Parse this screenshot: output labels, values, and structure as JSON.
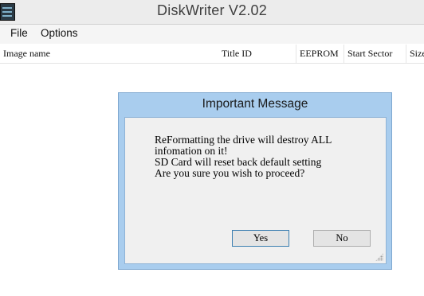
{
  "window": {
    "title": "DiskWriter V2.02",
    "icon": "app-icon"
  },
  "menu": {
    "file": "File",
    "options": "Options"
  },
  "table": {
    "columns": [
      "Image name",
      "Title ID",
      "EEPROM",
      "Start Sector",
      "Size"
    ]
  },
  "dialog": {
    "title": "Important Message",
    "lines": [
      "ReFormatting the drive will destroy ALL",
      "infomation on it!",
      "SD Card will reset back default setting",
      "Are you sure you wish to proceed?"
    ],
    "yes_label": "Yes",
    "no_label": "No"
  }
}
